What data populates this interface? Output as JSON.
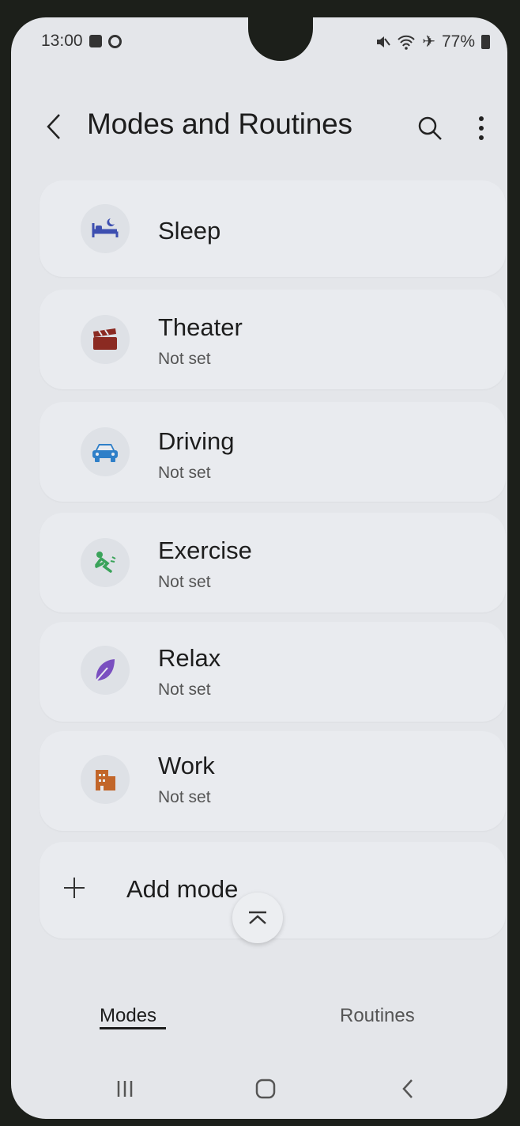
{
  "status_bar": {
    "time": "13:00",
    "battery": "77%"
  },
  "header": {
    "title": "Modes and Routines"
  },
  "modes": [
    {
      "name": "Sleep",
      "subtitle": "",
      "icon": "bed-icon",
      "color": "#3d4fb0"
    },
    {
      "name": "Theater",
      "subtitle": "Not set",
      "icon": "clapperboard-icon",
      "color": "#8b2a22"
    },
    {
      "name": "Driving",
      "subtitle": "Not set",
      "icon": "car-icon",
      "color": "#2f7fc8"
    },
    {
      "name": "Exercise",
      "subtitle": "Not set",
      "icon": "running-person-icon",
      "color": "#3aa35a"
    },
    {
      "name": "Relax",
      "subtitle": "Not set",
      "icon": "leaf-icon",
      "color": "#7a4fc0"
    },
    {
      "name": "Work",
      "subtitle": "Not set",
      "icon": "building-icon",
      "color": "#c2662a"
    }
  ],
  "add_mode": {
    "label": "Add mode"
  },
  "tabs": {
    "modes": "Modes",
    "routines": "Routines"
  }
}
